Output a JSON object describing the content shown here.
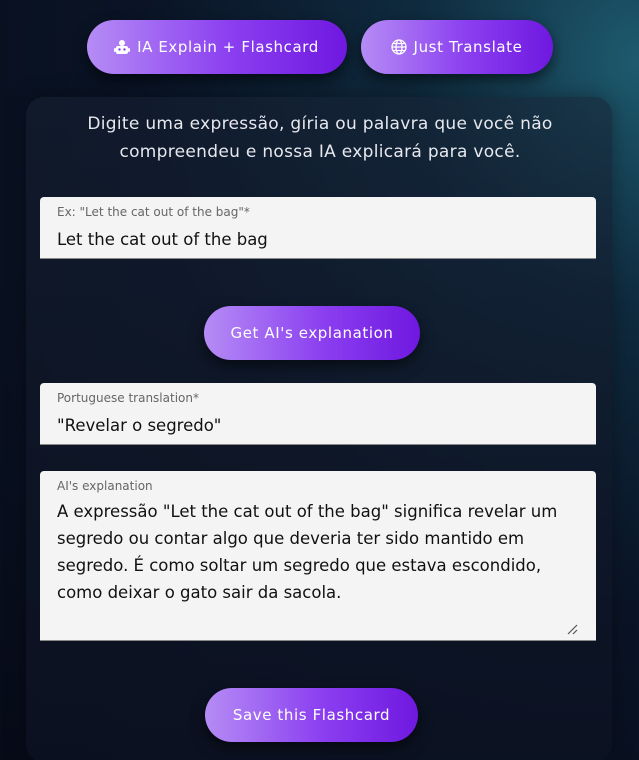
{
  "header": {
    "explain_label": "IA Explain + Flashcard",
    "explain_icon": "robot-icon",
    "translate_label": "Just Translate",
    "translate_icon": "globe-icon"
  },
  "intro_text": "Digite uma expressão, gíria ou palavra que você não compreendeu e nossa IA explicará para você.",
  "expression_field": {
    "label": "Ex: \"Let the cat out of the bag\"*",
    "value": "Let the cat out of the bag"
  },
  "get_explanation_label": "Get AI's explanation",
  "translation_field": {
    "label": "Portuguese translation*",
    "value": "\"Revelar o segredo\""
  },
  "explanation_field": {
    "label": "AI's explanation",
    "value": "A expressão \"Let the cat out of the bag\" significa revelar um segredo ou contar algo que deveria ter sido mantido em segredo. É como soltar um segredo que estava escondido, como deixar o gato sair da sacola."
  },
  "save_label": "Save this Flashcard",
  "colors": {
    "button_gradient_start": "#b58cf5",
    "button_gradient_end": "#6f18e0",
    "field_background": "#f4f4f4"
  }
}
